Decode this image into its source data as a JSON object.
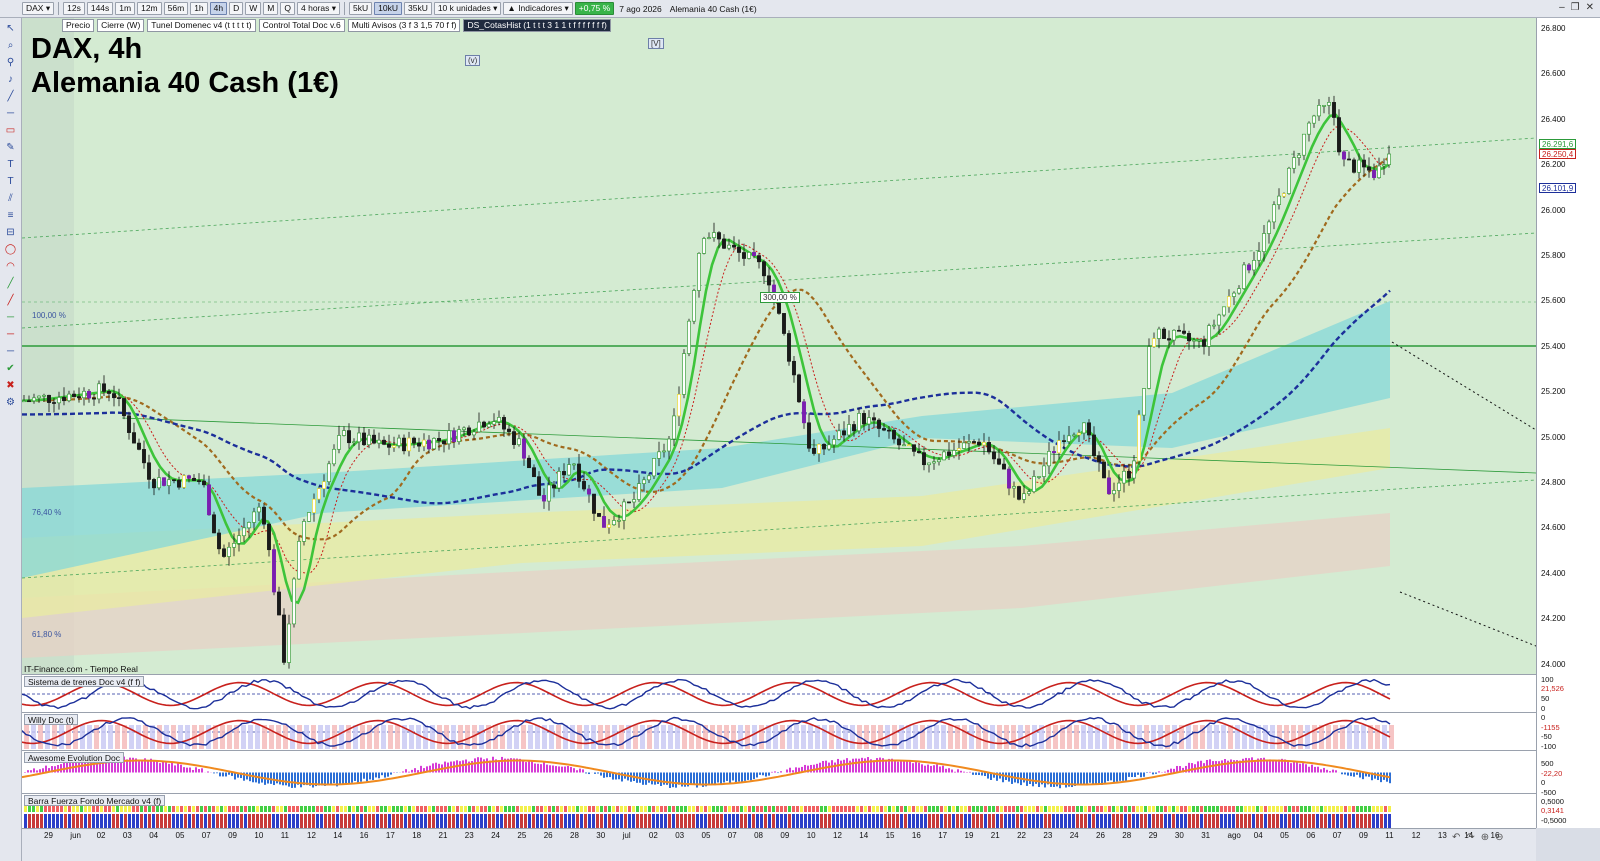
{
  "toolbar": {
    "symbol": "DAX",
    "timeframes": [
      "12s",
      "144s",
      "1m",
      "12m",
      "56m",
      "1h",
      "4h",
      "D",
      "W",
      "M",
      "Q"
    ],
    "active_timeframe": "4h",
    "period_select": "4 horas",
    "units": [
      "5kU",
      "10kU",
      "35kU"
    ],
    "active_unit": "10kU",
    "units_select": "10 k unidades",
    "indicators_button": "Indicadores",
    "change_pct": "+0,75 %",
    "date": "7 ago 2026",
    "instrument": "Alemania 40 Cash (1€)"
  },
  "series_tags": [
    "Precio",
    "Cierre (W)",
    "Tunel Domenec v4 (t t t t t)",
    "Control Total Doc v.6",
    "Multi Avisos (3 f 3 1,5 70 f f)",
    "DS_CotasHist (1 t t t 3 1 1 t f f f f f f f)"
  ],
  "chart": {
    "title_line1": "DAX, 4h",
    "title_line2": "Alemania 40 Cash (1€)",
    "badge_v1": "(v)",
    "badge_v2": "[V]",
    "fib_100": "100,00 %",
    "fib_76": "76,40 %",
    "fib_61": "61,80 %",
    "label_300": "300,00 %",
    "source": "IT-Finance.com - Tiempo Real"
  },
  "price_axis": {
    "ticks": [
      "26.800",
      "26.600",
      "26.400",
      "26.200",
      "26.000",
      "25.800",
      "25.600",
      "25.400",
      "25.200",
      "25.000",
      "24.800",
      "24.600",
      "24.400",
      "24.200",
      "24.000"
    ],
    "tags": [
      {
        "text": "26.291,6",
        "color": "#2c9a3a"
      },
      {
        "text": "26.250,4",
        "color": "#c8211d"
      },
      {
        "text": "26.101,9",
        "color": "#1c2f9a"
      }
    ]
  },
  "panels": [
    {
      "name": "Sistema de trenes Doc v4 (f f)",
      "axis": [
        "100",
        "21,526",
        "50",
        "0"
      ]
    },
    {
      "name": "Willy Doc (t)",
      "axis": [
        "0",
        "-1155",
        "-50",
        "-100"
      ]
    },
    {
      "name": "Awesome Evolution Doc",
      "axis": [
        "500",
        "-22,20",
        "0",
        "-500"
      ]
    },
    {
      "name": "Barra Fuerza Fondo Mercado v4 (f)",
      "axis": [
        "0,5000",
        "0,3141",
        "-0,5000"
      ]
    }
  ],
  "date_axis": [
    "29",
    "jun",
    "02",
    "03",
    "04",
    "05",
    "07",
    "09",
    "10",
    "11",
    "12",
    "14",
    "16",
    "17",
    "18",
    "21",
    "23",
    "24",
    "25",
    "26",
    "28",
    "30",
    "jul",
    "02",
    "03",
    "05",
    "07",
    "08",
    "09",
    "10",
    "12",
    "14",
    "15",
    "16",
    "17",
    "19",
    "21",
    "22",
    "23",
    "24",
    "26",
    "28",
    "29",
    "30",
    "31",
    "ago",
    "04",
    "05",
    "06",
    "07",
    "09",
    "11",
    "12",
    "13",
    "14",
    "16"
  ]
}
